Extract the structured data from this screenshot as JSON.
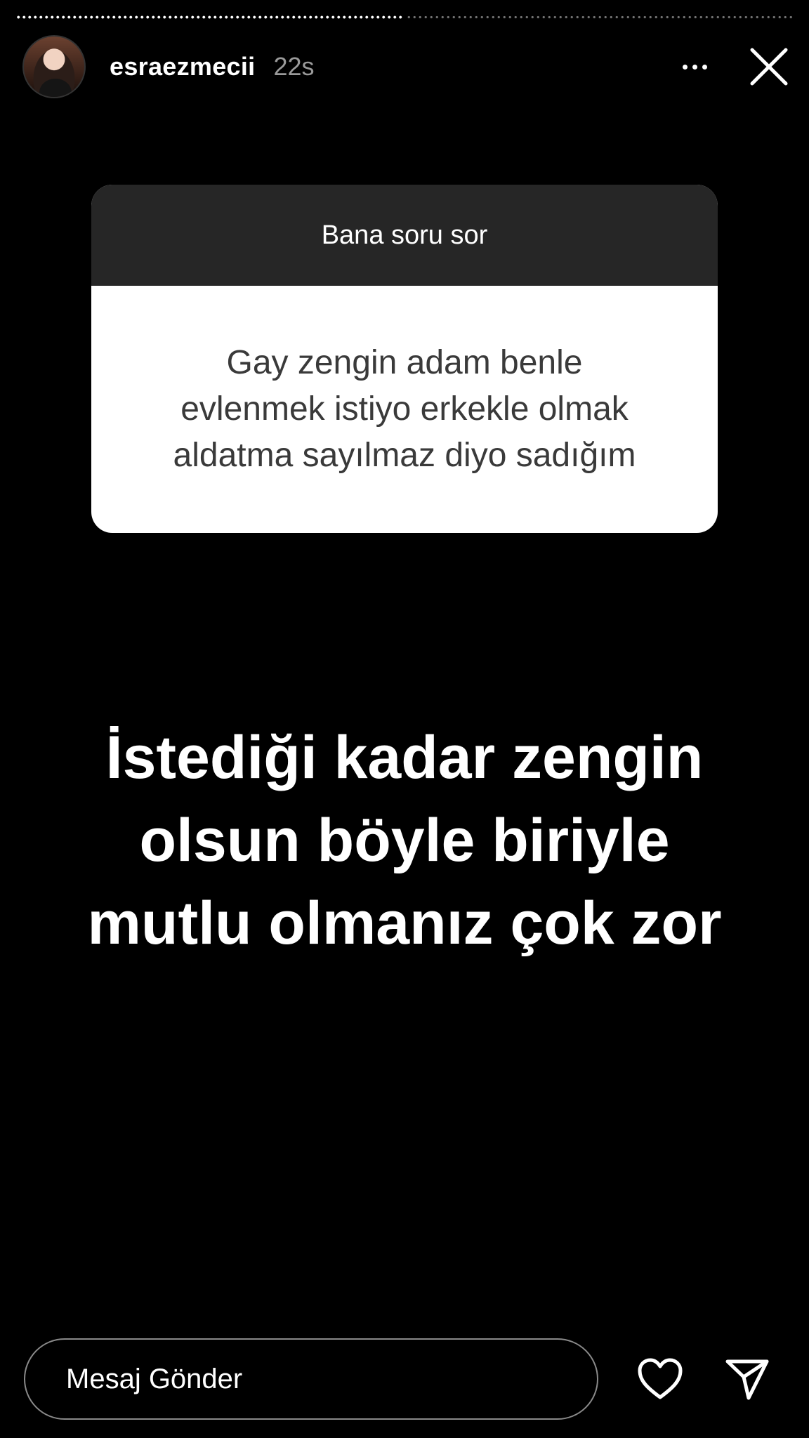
{
  "story": {
    "segments_total": 2,
    "segments_viewed": 1
  },
  "header": {
    "avatar_icon": "profile-photo",
    "username": "esraezmecii",
    "time_ago": "22s",
    "more_icon": "more-horizontal-icon",
    "close_icon": "close-icon"
  },
  "question_sticker": {
    "title": "Bana soru sor",
    "question": "Gay zengin adam benle\nevlenmek istiyo erkekle olmak\naldatma sayılmaz diyo sadığım"
  },
  "answer": {
    "text": "İstediği kadar zengin\nolsun böyle biriyle\nmutlu olmanız çok zor"
  },
  "footer": {
    "message_placeholder": "Mesaj Gönder",
    "like_icon": "heart-icon",
    "share_icon": "send-icon"
  },
  "colors": {
    "background": "#000000",
    "sticker_header": "#262626",
    "sticker_body": "#ffffff",
    "sticker_text": "#3a3a3a",
    "secondary_text": "#9a9a9a"
  }
}
